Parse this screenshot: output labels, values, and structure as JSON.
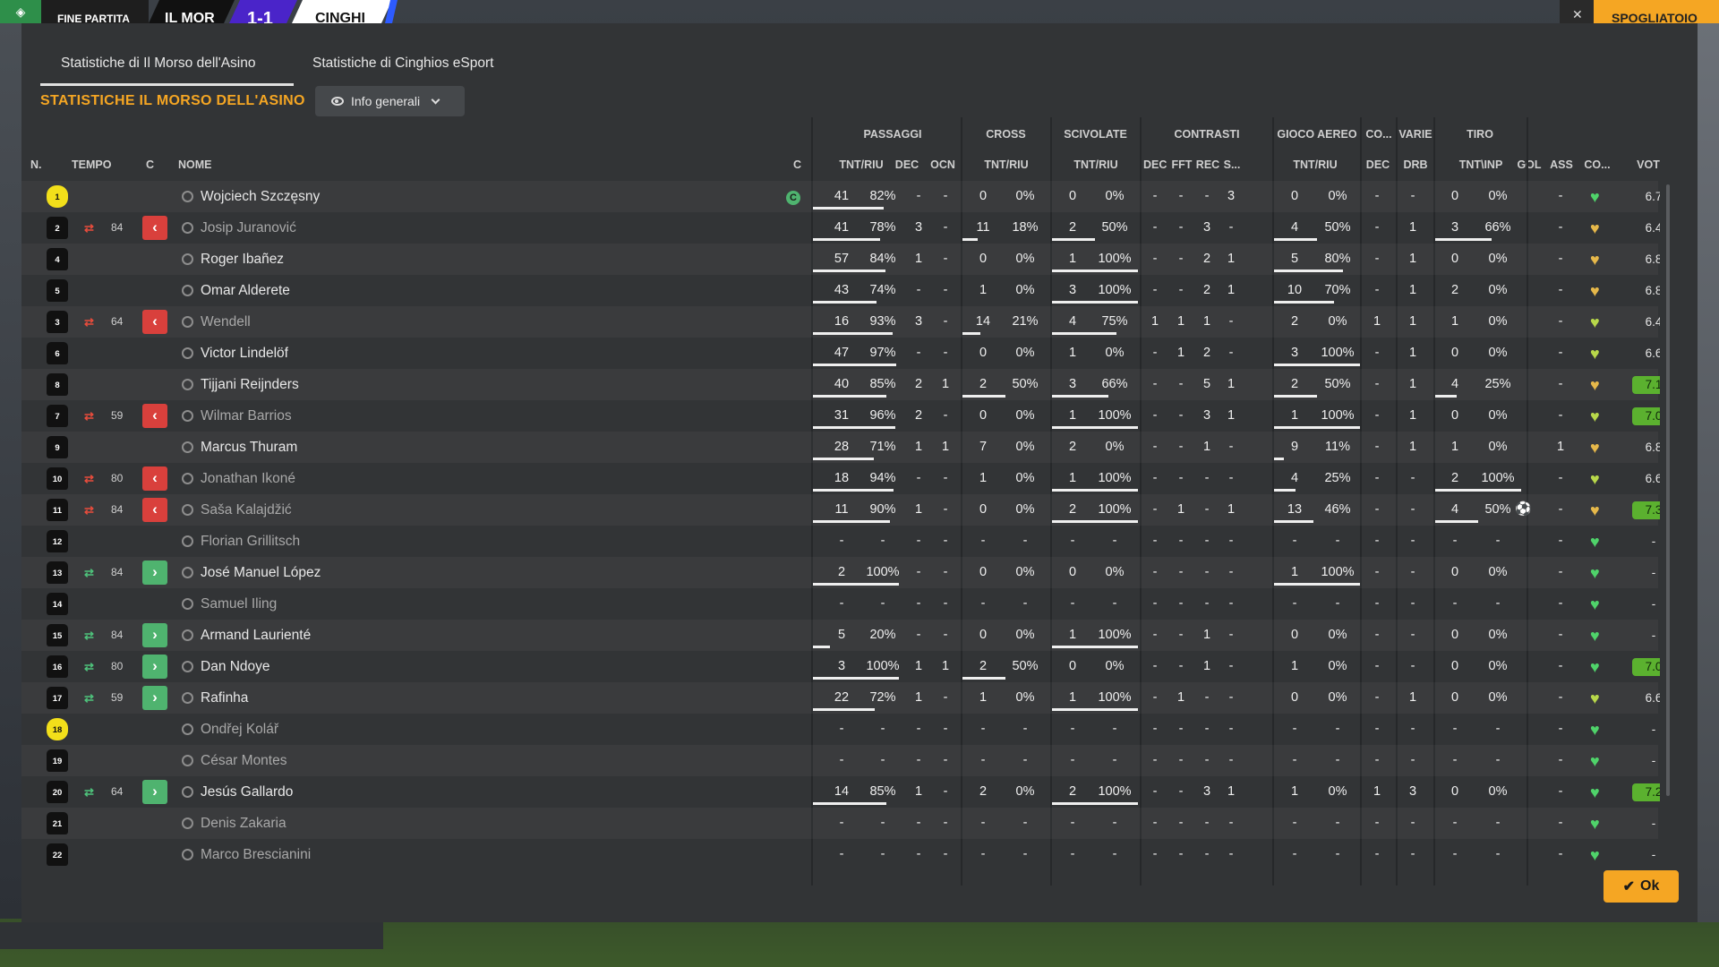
{
  "topbar": {
    "status": "FINE PARTITA",
    "home": "IL MOR",
    "score": "1-1",
    "away": "CINGHI",
    "close": "✕",
    "right_button": "SPOGLIATOIO"
  },
  "tabs": [
    "Statistiche di Il Morso dell'Asino",
    "Statistiche di Cinghios eSport"
  ],
  "section_title": "STATISTICHE IL MORSO DELL'ASINO",
  "view_dropdown": "Info generali",
  "group_headers": [
    "PASSAGGI",
    "CROSS",
    "SCIVOLATE",
    "CONTRASTI",
    "GIOCO AEREO",
    "CO...",
    "VARIE",
    "TIRO"
  ],
  "column_headers": [
    "N.",
    "TEMPO",
    "C",
    "NOME",
    "C",
    "TNT/RIU",
    "DEC",
    "OCN",
    "TNT/RIU",
    "TNT/RIU",
    "DEC",
    "FFT",
    "REC",
    "S...",
    "TNT/RIU",
    "DEC",
    "DRB",
    "TNT\\INP",
    "GOL",
    "ASS",
    "CO...",
    "VOT"
  ],
  "captain_badge": "C",
  "ok_button": "Ok",
  "colors": {
    "accent": "#f5a623",
    "sub_out": "#d9403c",
    "sub_in": "#4fb36f",
    "high_rating": "#5bb12f"
  },
  "players": [
    {
      "num": "1",
      "gk": true,
      "sub": "",
      "min": "",
      "name": "Wojciech Szczęsny",
      "dim": false,
      "captain": true,
      "pas": "41",
      "pasp": "82%",
      "pasf": 0.82,
      "dec": "-",
      "ocn": "-",
      "cro": "0",
      "crop": "0%",
      "crof": 0,
      "sci": "0",
      "scip": "0%",
      "scif": 0,
      "cdec": "-",
      "fft": "-",
      "rec": "-",
      "s": "3",
      "aer": "0",
      "aerp": "0%",
      "aerf": 0,
      "codec": "-",
      "drb": "-",
      "tir": "0",
      "tirp": "0%",
      "tirf": 0,
      "gol": "",
      "ass": "-",
      "mood": "#4fd36a",
      "vot": "6.7",
      "hi": false
    },
    {
      "num": "2",
      "gk": false,
      "sub": "out",
      "min": "84",
      "name": "Josip Juranović",
      "dim": true,
      "captain": false,
      "pas": "41",
      "pasp": "78%",
      "pasf": 0.78,
      "dec": "3",
      "ocn": "-",
      "cro": "11",
      "crop": "18%",
      "crof": 0.18,
      "sci": "2",
      "scip": "50%",
      "scif": 0.5,
      "cdec": "-",
      "fft": "-",
      "rec": "3",
      "s": "-",
      "aer": "4",
      "aerp": "50%",
      "aerf": 0.5,
      "codec": "-",
      "drb": "1",
      "tir": "3",
      "tirp": "66%",
      "tirf": 0.66,
      "gol": "",
      "ass": "-",
      "mood": "#e6b84a",
      "vot": "6.4",
      "hi": false
    },
    {
      "num": "4",
      "gk": false,
      "sub": "",
      "min": "",
      "name": "Roger Ibañez",
      "dim": false,
      "captain": false,
      "pas": "57",
      "pasp": "84%",
      "pasf": 0.84,
      "dec": "1",
      "ocn": "-",
      "cro": "0",
      "crop": "0%",
      "crof": 0,
      "sci": "1",
      "scip": "100%",
      "scif": 1,
      "cdec": "-",
      "fft": "-",
      "rec": "2",
      "s": "1",
      "aer": "5",
      "aerp": "80%",
      "aerf": 0.8,
      "codec": "-",
      "drb": "1",
      "tir": "0",
      "tirp": "0%",
      "tirf": 0,
      "gol": "",
      "ass": "-",
      "mood": "#e6b84a",
      "vot": "6.8",
      "hi": false
    },
    {
      "num": "5",
      "gk": false,
      "sub": "",
      "min": "",
      "name": "Omar Alderete",
      "dim": false,
      "captain": false,
      "pas": "43",
      "pasp": "74%",
      "pasf": 0.74,
      "dec": "-",
      "ocn": "-",
      "cro": "1",
      "crop": "0%",
      "crof": 0,
      "sci": "3",
      "scip": "100%",
      "scif": 1,
      "cdec": "-",
      "fft": "-",
      "rec": "2",
      "s": "1",
      "aer": "10",
      "aerp": "70%",
      "aerf": 0.7,
      "codec": "-",
      "drb": "1",
      "tir": "2",
      "tirp": "0%",
      "tirf": 0,
      "gol": "",
      "ass": "-",
      "mood": "#e6b84a",
      "vot": "6.8",
      "hi": false
    },
    {
      "num": "3",
      "gk": false,
      "sub": "out",
      "min": "64",
      "name": "Wendell",
      "dim": true,
      "captain": false,
      "pas": "16",
      "pasp": "93%",
      "pasf": 0.93,
      "dec": "3",
      "ocn": "-",
      "cro": "14",
      "crop": "21%",
      "crof": 0.21,
      "sci": "4",
      "scip": "75%",
      "scif": 0.75,
      "cdec": "1",
      "fft": "1",
      "rec": "1",
      "s": "-",
      "aer": "2",
      "aerp": "0%",
      "aerf": 0,
      "codec": "1",
      "drb": "1",
      "tir": "1",
      "tirp": "0%",
      "tirf": 0,
      "gol": "",
      "ass": "-",
      "mood": "#b8d84a",
      "vot": "6.4",
      "hi": false
    },
    {
      "num": "6",
      "gk": false,
      "sub": "",
      "min": "",
      "name": "Victor Lindelöf",
      "dim": false,
      "captain": false,
      "pas": "47",
      "pasp": "97%",
      "pasf": 0.97,
      "dec": "-",
      "ocn": "-",
      "cro": "0",
      "crop": "0%",
      "crof": 0,
      "sci": "1",
      "scip": "0%",
      "scif": 0,
      "cdec": "-",
      "fft": "1",
      "rec": "2",
      "s": "-",
      "aer": "3",
      "aerp": "100%",
      "aerf": 1,
      "codec": "-",
      "drb": "1",
      "tir": "0",
      "tirp": "0%",
      "tirf": 0,
      "gol": "",
      "ass": "-",
      "mood": "#b8d84a",
      "vot": "6.6",
      "hi": false
    },
    {
      "num": "8",
      "gk": false,
      "sub": "",
      "min": "",
      "name": "Tijjani Reijnders",
      "dim": false,
      "captain": false,
      "pas": "40",
      "pasp": "85%",
      "pasf": 0.85,
      "dec": "2",
      "ocn": "1",
      "cro": "2",
      "crop": "50%",
      "crof": 0.5,
      "sci": "3",
      "scip": "66%",
      "scif": 0.66,
      "cdec": "-",
      "fft": "-",
      "rec": "5",
      "s": "1",
      "aer": "2",
      "aerp": "50%",
      "aerf": 0.5,
      "codec": "-",
      "drb": "1",
      "tir": "4",
      "tirp": "25%",
      "tirf": 0.25,
      "gol": "",
      "ass": "-",
      "mood": "#e6b84a",
      "vot": "7.1",
      "hi": true
    },
    {
      "num": "7",
      "gk": false,
      "sub": "out",
      "min": "59",
      "name": "Wilmar Barrios",
      "dim": true,
      "captain": false,
      "pas": "31",
      "pasp": "96%",
      "pasf": 0.96,
      "dec": "2",
      "ocn": "-",
      "cro": "0",
      "crop": "0%",
      "crof": 0,
      "sci": "1",
      "scip": "100%",
      "scif": 1,
      "cdec": "-",
      "fft": "-",
      "rec": "3",
      "s": "1",
      "aer": "1",
      "aerp": "100%",
      "aerf": 1,
      "codec": "-",
      "drb": "1",
      "tir": "0",
      "tirp": "0%",
      "tirf": 0,
      "gol": "",
      "ass": "-",
      "mood": "#b8d84a",
      "vot": "7.0",
      "hi": true
    },
    {
      "num": "9",
      "gk": false,
      "sub": "",
      "min": "",
      "name": "Marcus Thuram",
      "dim": false,
      "captain": false,
      "pas": "28",
      "pasp": "71%",
      "pasf": 0.71,
      "dec": "1",
      "ocn": "1",
      "cro": "7",
      "crop": "0%",
      "crof": 0,
      "sci": "2",
      "scip": "0%",
      "scif": 0,
      "cdec": "-",
      "fft": "-",
      "rec": "1",
      "s": "-",
      "aer": "9",
      "aerp": "11%",
      "aerf": 0.11,
      "codec": "-",
      "drb": "1",
      "tir": "1",
      "tirp": "0%",
      "tirf": 0,
      "gol": "",
      "ass": "1",
      "mood": "#e6b84a",
      "vot": "6.8",
      "hi": false
    },
    {
      "num": "10",
      "gk": false,
      "sub": "out",
      "min": "80",
      "name": "Jonathan Ikoné",
      "dim": true,
      "captain": false,
      "pas": "18",
      "pasp": "94%",
      "pasf": 0.94,
      "dec": "-",
      "ocn": "-",
      "cro": "1",
      "crop": "0%",
      "crof": 0,
      "sci": "1",
      "scip": "100%",
      "scif": 1,
      "cdec": "-",
      "fft": "-",
      "rec": "-",
      "s": "-",
      "aer": "4",
      "aerp": "25%",
      "aerf": 0.25,
      "codec": "-",
      "drb": "-",
      "tir": "2",
      "tirp": "100%",
      "tirf": 1,
      "gol": "",
      "ass": "-",
      "mood": "#b8d84a",
      "vot": "6.6",
      "hi": false
    },
    {
      "num": "11",
      "gk": false,
      "sub": "out",
      "min": "84",
      "name": "Saša Kalajdžić",
      "dim": true,
      "captain": false,
      "pas": "11",
      "pasp": "90%",
      "pasf": 0.9,
      "dec": "1",
      "ocn": "-",
      "cro": "0",
      "crop": "0%",
      "crof": 0,
      "sci": "2",
      "scip": "100%",
      "scif": 1,
      "cdec": "-",
      "fft": "1",
      "rec": "-",
      "s": "1",
      "aer": "13",
      "aerp": "46%",
      "aerf": 0.46,
      "codec": "-",
      "drb": "-",
      "tir": "4",
      "tirp": "50%",
      "tirf": 0.5,
      "gol": "⚽",
      "ass": "-",
      "mood": "#e6b84a",
      "vot": "7.3",
      "hi": true
    },
    {
      "num": "12",
      "gk": false,
      "sub": "",
      "min": "",
      "name": "Florian Grillitsch",
      "dim": true,
      "captain": false,
      "pas": "-",
      "pasp": "-",
      "pasf": 0,
      "dec": "-",
      "ocn": "-",
      "cro": "-",
      "crop": "-",
      "crof": 0,
      "sci": "-",
      "scip": "-",
      "scif": 0,
      "cdec": "-",
      "fft": "-",
      "rec": "-",
      "s": "-",
      "aer": "-",
      "aerp": "-",
      "aerf": 0,
      "codec": "-",
      "drb": "-",
      "tir": "-",
      "tirp": "-",
      "tirf": 0,
      "gol": "",
      "ass": "-",
      "mood": "#4fd36a",
      "vot": "-",
      "hi": false
    },
    {
      "num": "13",
      "gk": false,
      "sub": "in",
      "min": "84",
      "name": "José Manuel López",
      "dim": false,
      "captain": false,
      "pas": "2",
      "pasp": "100%",
      "pasf": 1,
      "dec": "-",
      "ocn": "-",
      "cro": "0",
      "crop": "0%",
      "crof": 0,
      "sci": "0",
      "scip": "0%",
      "scif": 0,
      "cdec": "-",
      "fft": "-",
      "rec": "-",
      "s": "-",
      "aer": "1",
      "aerp": "100%",
      "aerf": 1,
      "codec": "-",
      "drb": "-",
      "tir": "0",
      "tirp": "0%",
      "tirf": 0,
      "gol": "",
      "ass": "-",
      "mood": "#4fd36a",
      "vot": "-",
      "hi": false
    },
    {
      "num": "14",
      "gk": false,
      "sub": "",
      "min": "",
      "name": "Samuel Iling",
      "dim": true,
      "captain": false,
      "pas": "-",
      "pasp": "-",
      "pasf": 0,
      "dec": "-",
      "ocn": "-",
      "cro": "-",
      "crop": "-",
      "crof": 0,
      "sci": "-",
      "scip": "-",
      "scif": 0,
      "cdec": "-",
      "fft": "-",
      "rec": "-",
      "s": "-",
      "aer": "-",
      "aerp": "-",
      "aerf": 0,
      "codec": "-",
      "drb": "-",
      "tir": "-",
      "tirp": "-",
      "tirf": 0,
      "gol": "",
      "ass": "-",
      "mood": "#4fd36a",
      "vot": "-",
      "hi": false
    },
    {
      "num": "15",
      "gk": false,
      "sub": "in",
      "min": "84",
      "name": "Armand Laurienté",
      "dim": false,
      "captain": false,
      "pas": "5",
      "pasp": "20%",
      "pasf": 0.2,
      "dec": "-",
      "ocn": "-",
      "cro": "0",
      "crop": "0%",
      "crof": 0,
      "sci": "1",
      "scip": "100%",
      "scif": 1,
      "cdec": "-",
      "fft": "-",
      "rec": "1",
      "s": "-",
      "aer": "0",
      "aerp": "0%",
      "aerf": 0,
      "codec": "-",
      "drb": "-",
      "tir": "0",
      "tirp": "0%",
      "tirf": 0,
      "gol": "",
      "ass": "-",
      "mood": "#4fd36a",
      "vot": "-",
      "hi": false
    },
    {
      "num": "16",
      "gk": false,
      "sub": "in",
      "min": "80",
      "name": "Dan Ndoye",
      "dim": false,
      "captain": false,
      "pas": "3",
      "pasp": "100%",
      "pasf": 1,
      "dec": "1",
      "ocn": "1",
      "cro": "2",
      "crop": "50%",
      "crof": 0.5,
      "sci": "0",
      "scip": "0%",
      "scif": 0,
      "cdec": "-",
      "fft": "-",
      "rec": "1",
      "s": "-",
      "aer": "1",
      "aerp": "0%",
      "aerf": 0,
      "codec": "-",
      "drb": "-",
      "tir": "0",
      "tirp": "0%",
      "tirf": 0,
      "gol": "",
      "ass": "-",
      "mood": "#4fd36a",
      "vot": "7.0",
      "hi": true
    },
    {
      "num": "17",
      "gk": false,
      "sub": "in",
      "min": "59",
      "name": "Rafinha",
      "dim": false,
      "captain": false,
      "pas": "22",
      "pasp": "72%",
      "pasf": 0.72,
      "dec": "1",
      "ocn": "-",
      "cro": "1",
      "crop": "0%",
      "crof": 0,
      "sci": "1",
      "scip": "100%",
      "scif": 1,
      "cdec": "-",
      "fft": "1",
      "rec": "-",
      "s": "-",
      "aer": "0",
      "aerp": "0%",
      "aerf": 0,
      "codec": "-",
      "drb": "1",
      "tir": "0",
      "tirp": "0%",
      "tirf": 0,
      "gol": "",
      "ass": "-",
      "mood": "#b8d84a",
      "vot": "6.6",
      "hi": false
    },
    {
      "num": "18",
      "gk": true,
      "sub": "",
      "min": "",
      "name": "Ondřej Kolář",
      "dim": true,
      "captain": false,
      "pas": "-",
      "pasp": "-",
      "pasf": 0,
      "dec": "-",
      "ocn": "-",
      "cro": "-",
      "crop": "-",
      "crof": 0,
      "sci": "-",
      "scip": "-",
      "scif": 0,
      "cdec": "-",
      "fft": "-",
      "rec": "-",
      "s": "-",
      "aer": "-",
      "aerp": "-",
      "aerf": 0,
      "codec": "-",
      "drb": "-",
      "tir": "-",
      "tirp": "-",
      "tirf": 0,
      "gol": "",
      "ass": "-",
      "mood": "#4fd36a",
      "vot": "-",
      "hi": false
    },
    {
      "num": "19",
      "gk": false,
      "sub": "",
      "min": "",
      "name": "César Montes",
      "dim": true,
      "captain": false,
      "pas": "-",
      "pasp": "-",
      "pasf": 0,
      "dec": "-",
      "ocn": "-",
      "cro": "-",
      "crop": "-",
      "crof": 0,
      "sci": "-",
      "scip": "-",
      "scif": 0,
      "cdec": "-",
      "fft": "-",
      "rec": "-",
      "s": "-",
      "aer": "-",
      "aerp": "-",
      "aerf": 0,
      "codec": "-",
      "drb": "-",
      "tir": "-",
      "tirp": "-",
      "tirf": 0,
      "gol": "",
      "ass": "-",
      "mood": "#4fd36a",
      "vot": "-",
      "hi": false
    },
    {
      "num": "20",
      "gk": false,
      "sub": "in",
      "min": "64",
      "name": "Jesús Gallardo",
      "dim": false,
      "captain": false,
      "pas": "14",
      "pasp": "85%",
      "pasf": 0.85,
      "dec": "1",
      "ocn": "-",
      "cro": "2",
      "crop": "0%",
      "crof": 0,
      "sci": "2",
      "scip": "100%",
      "scif": 1,
      "cdec": "-",
      "fft": "-",
      "rec": "3",
      "s": "1",
      "aer": "1",
      "aerp": "0%",
      "aerf": 0,
      "codec": "1",
      "drb": "3",
      "tir": "0",
      "tirp": "0%",
      "tirf": 0,
      "gol": "",
      "ass": "-",
      "mood": "#4fd36a",
      "vot": "7.2",
      "hi": true
    },
    {
      "num": "21",
      "gk": false,
      "sub": "",
      "min": "",
      "name": "Denis Zakaria",
      "dim": true,
      "captain": false,
      "pas": "-",
      "pasp": "-",
      "pasf": 0,
      "dec": "-",
      "ocn": "-",
      "cro": "-",
      "crop": "-",
      "crof": 0,
      "sci": "-",
      "scip": "-",
      "scif": 0,
      "cdec": "-",
      "fft": "-",
      "rec": "-",
      "s": "-",
      "aer": "-",
      "aerp": "-",
      "aerf": 0,
      "codec": "-",
      "drb": "-",
      "tir": "-",
      "tirp": "-",
      "tirf": 0,
      "gol": "",
      "ass": "-",
      "mood": "#4fd36a",
      "vot": "-",
      "hi": false
    },
    {
      "num": "22",
      "gk": false,
      "sub": "",
      "min": "",
      "name": "Marco Brescianini",
      "dim": true,
      "captain": false,
      "pas": "-",
      "pasp": "-",
      "pasf": 0,
      "dec": "-",
      "ocn": "-",
      "cro": "-",
      "crop": "-",
      "crof": 0,
      "sci": "-",
      "scip": "-",
      "scif": 0,
      "cdec": "-",
      "fft": "-",
      "rec": "-",
      "s": "-",
      "aer": "-",
      "aerp": "-",
      "aerf": 0,
      "codec": "-",
      "drb": "-",
      "tir": "-",
      "tirp": "-",
      "tirf": 0,
      "gol": "",
      "ass": "-",
      "mood": "#4fd36a",
      "vot": "-",
      "hi": false
    }
  ]
}
